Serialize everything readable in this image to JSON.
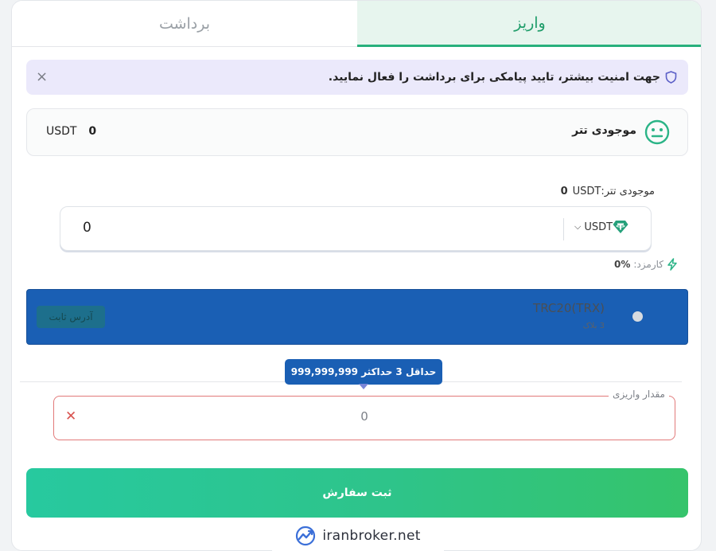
{
  "tabs": {
    "deposit": "واریز",
    "withdraw": "برداشت"
  },
  "alert": {
    "text": "جهت امنیت بیشتر، تایید پیامکی برای برداشت را فعال نمایید.",
    "close": "×"
  },
  "balance": {
    "label": "موجودی تتر",
    "value": "0",
    "unit": "USDT"
  },
  "balance_line": {
    "label": "موجودی تتر:",
    "value": "0",
    "unit": "USDT"
  },
  "amount": {
    "value": "0",
    "currency": "USDT"
  },
  "fee": {
    "label": "کارمزد:",
    "value": "0%"
  },
  "network": {
    "name": "TRC20(TRX)",
    "blocks": "3 بلاک",
    "tag": "آدرس ثابت"
  },
  "tooltip": {
    "text": "حداقل 3 حداکثر 999,999,999"
  },
  "deposit_field": {
    "legend": "مقدار واریزی",
    "value": "0",
    "clear": "✕"
  },
  "submit": {
    "label": "ثبت سفارش"
  },
  "watermark": {
    "text": "iranbroker.net"
  },
  "colors": {
    "accent": "#28b07c",
    "network_bg": "#1a5fb4",
    "error": "#e27a7a",
    "alert_bg": "#ebe9fb"
  }
}
